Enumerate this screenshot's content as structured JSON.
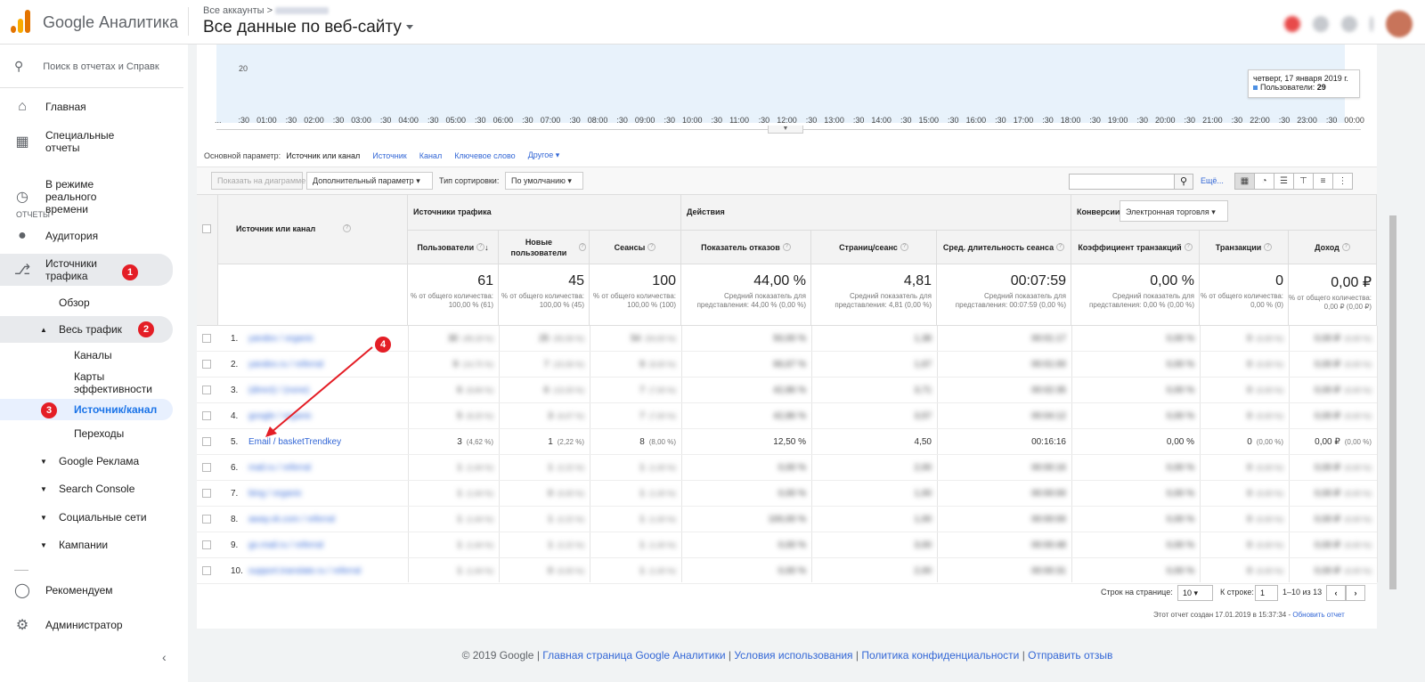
{
  "app": {
    "name": "Google Аналитика",
    "crumb": "Все аккаунты",
    "view_title": "Все данные по веб-сайту"
  },
  "sidebar": {
    "search_placeholder": "Поиск в отчетах и Справк",
    "home": "Главная",
    "custom": "Специальные отчеты",
    "section": "ОТЧЕТЫ",
    "realtime": "В режиме реального времени",
    "audience": "Аудитория",
    "acquisition": "Источники трафика",
    "overview": "Обзор",
    "all_traffic": "Весь трафик",
    "channels": "Каналы",
    "treemaps": "Карты эффективности",
    "source_medium": "Источник/канал",
    "referrals": "Переходы",
    "google_ads": "Google Реклама",
    "search_console": "Search Console",
    "social": "Социальные сети",
    "campaigns": "Кампании",
    "recommended": "Рекомендуем",
    "admin": "Администратор"
  },
  "badges": [
    "1",
    "2",
    "3",
    "4"
  ],
  "chart": {
    "y_label": "20",
    "tooltip_date": "четверг, 17 января 2019 г.",
    "tooltip_series": "Пользователи:",
    "tooltip_value": "29",
    "x_ticks": [
      "...",
      ":30",
      "01:00",
      ":30",
      "02:00",
      ":30",
      "03:00",
      ":30",
      "04:00",
      ":30",
      "05:00",
      ":30",
      "06:00",
      ":30",
      "07:00",
      ":30",
      "08:00",
      ":30",
      "09:00",
      ":30",
      "10:00",
      ":30",
      "11:00",
      ":30",
      "12:00",
      ":30",
      "13:00",
      ":30",
      "14:00",
      ":30",
      "15:00",
      ":30",
      "16:00",
      ":30",
      "17:00",
      ":30",
      "18:00",
      ":30",
      "19:00",
      ":30",
      "20:00",
      ":30",
      "21:00",
      ":30",
      "22:00",
      ":30",
      "23:00",
      ":30",
      "00:00"
    ]
  },
  "dims": {
    "label": "Основной параметр:",
    "current": "Источник или канал",
    "links": [
      "Источник",
      "Канал",
      "Ключевое слово",
      "Другое"
    ]
  },
  "toolbar": {
    "plot": "Показать на диаграмме",
    "secondary": "Дополнительный параметр",
    "sort_label": "Тип сортировки:",
    "sort_value": "По умолчанию",
    "more": "Ещё..."
  },
  "table": {
    "dim_header": "Источник или канал",
    "groups": [
      "Источники трафика",
      "Действия",
      "Конверсии"
    ],
    "conv_select": "Электронная торговля",
    "columns": [
      "Пользователи",
      "Новые пользователи",
      "Сеансы",
      "Показатель отказов",
      "Страниц/сеанс",
      "Сред. длительность сеанса",
      "Коэффициент транзакций",
      "Транзакции",
      "Доход"
    ],
    "totals": [
      {
        "big": "61",
        "sub": "% от общего количества: 100,00 % (61)"
      },
      {
        "big": "45",
        "sub": "% от общего количества: 100,00 % (45)"
      },
      {
        "big": "100",
        "sub": "% от общего количества: 100,00 % (100)"
      },
      {
        "big": "44,00 %",
        "sub": "Средний показатель для представления: 44,00 % (0,00 %)"
      },
      {
        "big": "4,81",
        "sub": "Средний показатель для представления: 4,81 (0,00 %)"
      },
      {
        "big": "00:07:59",
        "sub": "Средний показатель для представления: 00:07:59 (0,00 %)"
      },
      {
        "big": "0,00 %",
        "sub": "Средний показатель для представления: 0,00 % (0,00 %)"
      },
      {
        "big": "0",
        "sub": "% от общего количества: 0,00 % (0)"
      },
      {
        "big": "0,00 ₽",
        "sub": "% от общего количества: 0,00 ₽ (0,00 ₽)"
      }
    ],
    "rows": [
      {
        "n": "1.",
        "src": "yandex / organic",
        "vals": [
          "30",
          "(49,18 %)",
          "25",
          "(55,56 %)",
          "54",
          "(54,00 %)",
          "50,00 %",
          "1,38",
          "00:01:17",
          "0,00 %",
          "0",
          "(0,00 %)",
          "0,00 ₽",
          "(0,00 %)"
        ],
        "blur": true
      },
      {
        "n": "2.",
        "src": "yandex.ru / referral",
        "vals": [
          "9",
          "(14,75 %)",
          "7",
          "(15,56 %)",
          "9",
          "(9,00 %)",
          "66,67 %",
          "1,67",
          "00:01:00",
          "0,00 %",
          "0",
          "(0,00 %)",
          "0,00 ₽",
          "(0,00 %)"
        ],
        "blur": true
      },
      {
        "n": "3.",
        "src": "(direct) / (none)",
        "vals": [
          "6",
          "(9,84 %)",
          "6",
          "(13,33 %)",
          "7",
          "(7,00 %)",
          "42,86 %",
          "3,71",
          "00:02:35",
          "0,00 %",
          "0",
          "(0,00 %)",
          "0,00 ₽",
          "(0,00 %)"
        ],
        "blur": true
      },
      {
        "n": "4.",
        "src": "google / organic",
        "vals": [
          "5",
          "(8,20 %)",
          "3",
          "(6,67 %)",
          "7",
          "(7,00 %)",
          "42,86 %",
          "3,57",
          "00:04:12",
          "0,00 %",
          "0",
          "(0,00 %)",
          "0,00 ₽",
          "(0,00 %)"
        ],
        "blur": true
      },
      {
        "n": "5.",
        "src": "Email / basketTrendkey",
        "vals": [
          "3",
          "(4,62 %)",
          "1",
          "(2,22 %)",
          "8",
          "(8,00 %)",
          "12,50 %",
          "4,50",
          "00:16:16",
          "0,00 %",
          "0",
          "(0,00 %)",
          "0,00 ₽",
          "(0,00 %)"
        ],
        "blur": false
      },
      {
        "n": "6.",
        "src": "mail.ru / referral",
        "vals": [
          "1",
          "(1,64 %)",
          "1",
          "(2,22 %)",
          "1",
          "(1,00 %)",
          "0,00 %",
          "2,00",
          "00:00:16",
          "0,00 %",
          "0",
          "(0,00 %)",
          "0,00 ₽",
          "(0,00 %)"
        ],
        "blur": true
      },
      {
        "n": "7.",
        "src": "bing / organic",
        "vals": [
          "1",
          "(1,64 %)",
          "0",
          "(0,00 %)",
          "1",
          "(1,00 %)",
          "0,00 %",
          "1,00",
          "00:00:00",
          "0,00 %",
          "0",
          "(0,00 %)",
          "0,00 ₽",
          "(0,00 %)"
        ],
        "blur": true
      },
      {
        "n": "8.",
        "src": "away.vk.com / referral",
        "vals": [
          "1",
          "(1,64 %)",
          "1",
          "(2,22 %)",
          "1",
          "(1,00 %)",
          "100,00 %",
          "1,00",
          "00:00:00",
          "0,00 %",
          "0",
          "(0,00 %)",
          "0,00 ₽",
          "(0,00 %)"
        ],
        "blur": true
      },
      {
        "n": "9.",
        "src": "go.mail.ru / referral",
        "vals": [
          "1",
          "(1,64 %)",
          "1",
          "(2,22 %)",
          "1",
          "(1,00 %)",
          "0,00 %",
          "3,00",
          "00:00:48",
          "0,00 %",
          "0",
          "(0,00 %)",
          "0,00 ₽",
          "(0,00 %)"
        ],
        "blur": true
      },
      {
        "n": "10.",
        "src": "support.translate.ru / referral",
        "vals": [
          "1",
          "(1,64 %)",
          "0",
          "(0,00 %)",
          "1",
          "(1,00 %)",
          "0,00 %",
          "2,00",
          "00:00:31",
          "0,00 %",
          "0",
          "(0,00 %)",
          "0,00 ₽",
          "(0,00 %)"
        ],
        "blur": true
      }
    ]
  },
  "pager": {
    "rows_label": "Строк на странице:",
    "rows_value": "10",
    "goto_label": "К строке:",
    "goto_value": "1",
    "range": "1–10 из 13"
  },
  "created": {
    "text": "Этот отчет создан 17.01.2019 в 15:37:34 -",
    "link": "Обновить отчет"
  },
  "footer": {
    "copy": "© 2019 Google",
    "links": [
      "Главная страница Google Аналитики",
      "Условия использования",
      "Политика конфиденциальности",
      "Отправить отзыв"
    ]
  },
  "colors": {
    "accent": "#1a73e8",
    "badge": "#e41e26",
    "link": "#3367d6"
  }
}
